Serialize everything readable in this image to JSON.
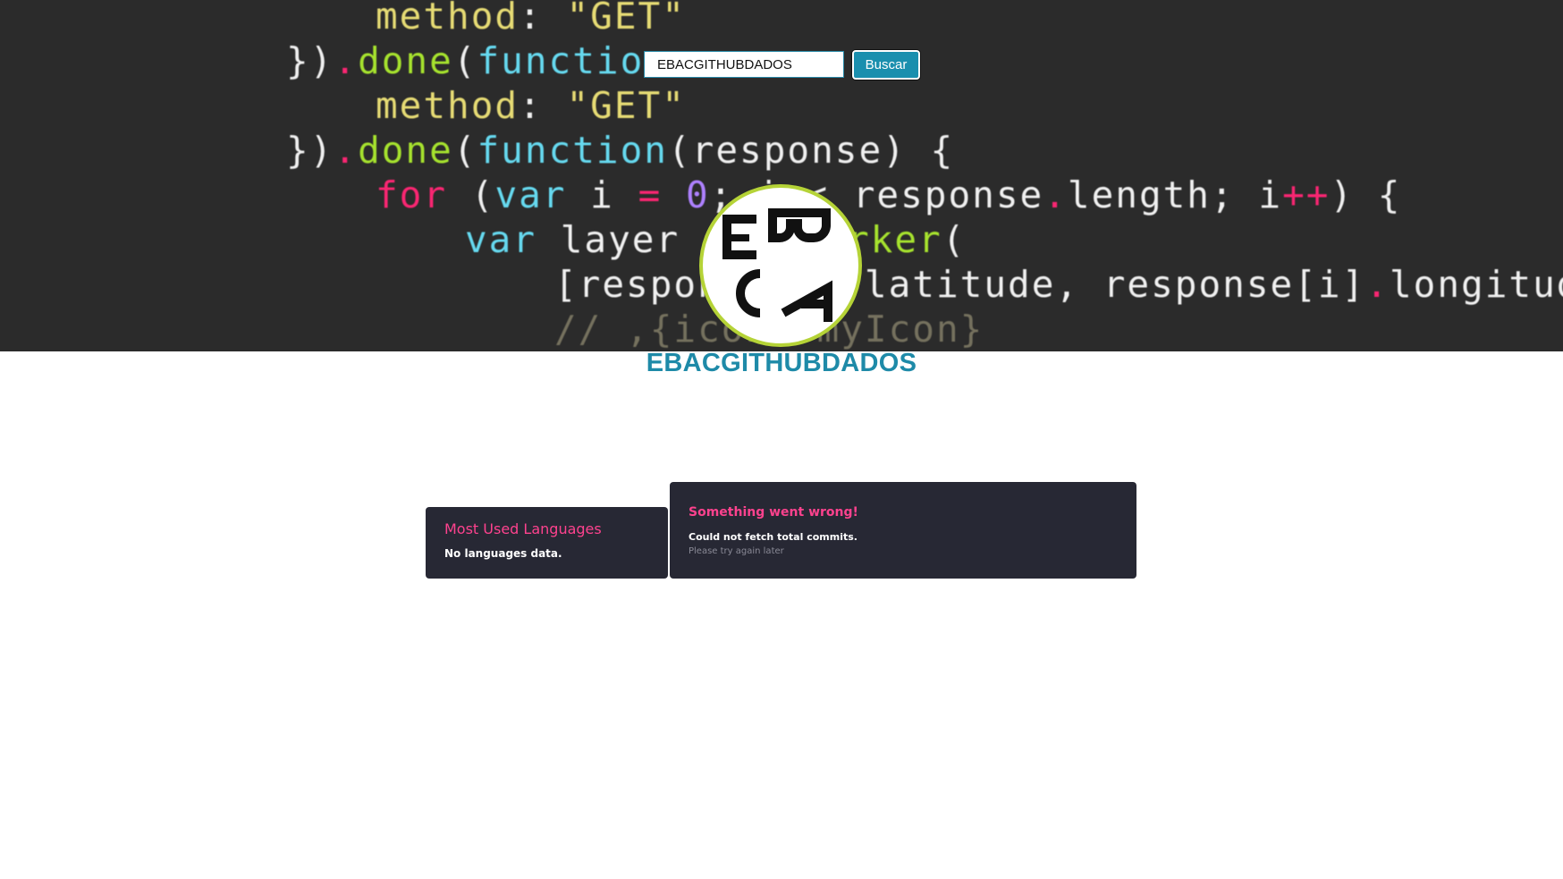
{
  "search": {
    "value": "EBACGITHUBDADOS",
    "button_label": "Buscar"
  },
  "profile": {
    "username": "EBACGITHUBDADOS",
    "avatar_logo": "EBAC"
  },
  "background_code": {
    "line1": "method: \"GET\"",
    "line2": "}).done(function",
    "line3": "method: \"GET\"",
    "line4": "}).done(function(response) {",
    "line5": "for (var i = 0; i < response.length; i++) {",
    "line6": "var layer = L.marker(",
    "line7": "[response[i].latitude, response[i].longitude]",
    "line8": "// ,{icon: myIcon}"
  },
  "languages_card": {
    "title": "Most Used Languages",
    "message": "No languages data."
  },
  "stats_card": {
    "title": "Something went wrong!",
    "message": "Could not fetch total commits.",
    "hint": "Please try again later"
  },
  "colors": {
    "accent": "#1e8aa8",
    "card_bg": "#272834",
    "card_title": "#fe428e",
    "avatar_border": "#b5d337"
  }
}
